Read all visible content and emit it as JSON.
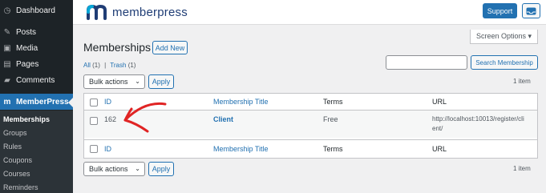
{
  "sidebar": {
    "items": [
      {
        "label": "Dashboard",
        "icon": "dashboard-icon"
      },
      {
        "label": "Posts",
        "icon": "pin-icon"
      },
      {
        "label": "Media",
        "icon": "media-icon"
      },
      {
        "label": "Pages",
        "icon": "pages-icon"
      },
      {
        "label": "Comments",
        "icon": "comments-icon"
      },
      {
        "label": "MemberPress",
        "icon": "memberpress-icon"
      }
    ],
    "subitems": [
      "Memberships",
      "Groups",
      "Rules",
      "Coupons",
      "Courses",
      "Reminders"
    ]
  },
  "topbar": {
    "brand": "memberpress",
    "support_label": "Support",
    "inbox_icon": "inbox-icon"
  },
  "screen_options": "Screen Options ▾",
  "page": {
    "title": "Memberships",
    "add_new": "Add New",
    "filters": {
      "all": "All",
      "all_count": "(1)",
      "sep": "|",
      "trash": "Trash",
      "trash_count": "(1)"
    },
    "search_placeholder": "",
    "search_button": "Search Membership",
    "bulk_actions": "Bulk actions",
    "apply": "Apply",
    "item_count": "1 item"
  },
  "table": {
    "columns": [
      "ID",
      "Membership Title",
      "Terms",
      "URL"
    ],
    "rows": [
      {
        "id": "162",
        "title": "Client",
        "terms": "Free",
        "url_line1": "http://localhost:10013/register/cli",
        "url_line2": "ent/"
      }
    ]
  },
  "colors": {
    "accent": "#2271b1",
    "sidebar": "#1d2327",
    "annotation": "#e02424"
  }
}
